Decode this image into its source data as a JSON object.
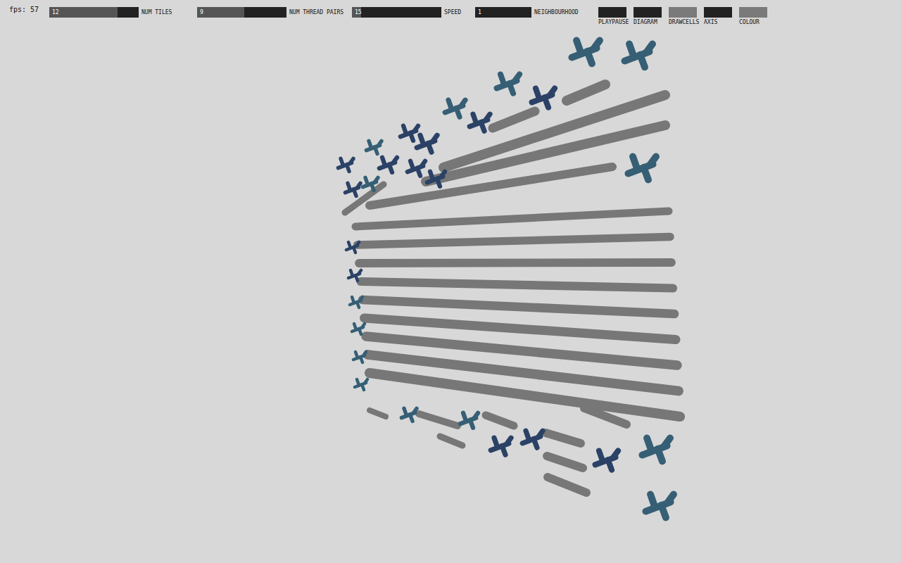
{
  "fps": "fps: 57",
  "sliders": [
    {
      "label": "NUM TILES",
      "value": "12",
      "level": 0.76
    },
    {
      "label": "NUM THREAD PAIRS",
      "value": "9",
      "level": 0.53
    },
    {
      "label": "SPEED",
      "value": "15",
      "level": 0.1
    },
    {
      "label": "NEIGHBOURHOOD",
      "value": "1",
      "level": 0
    }
  ],
  "toggles": [
    {
      "label": "PLAYPAUSE",
      "on": false
    },
    {
      "label": "DIAGRAM",
      "on": false
    },
    {
      "label": "DRAWCELLS",
      "on": true
    },
    {
      "label": "AXIS",
      "on": false
    },
    {
      "label": "COLOUR",
      "on": true
    }
  ]
}
